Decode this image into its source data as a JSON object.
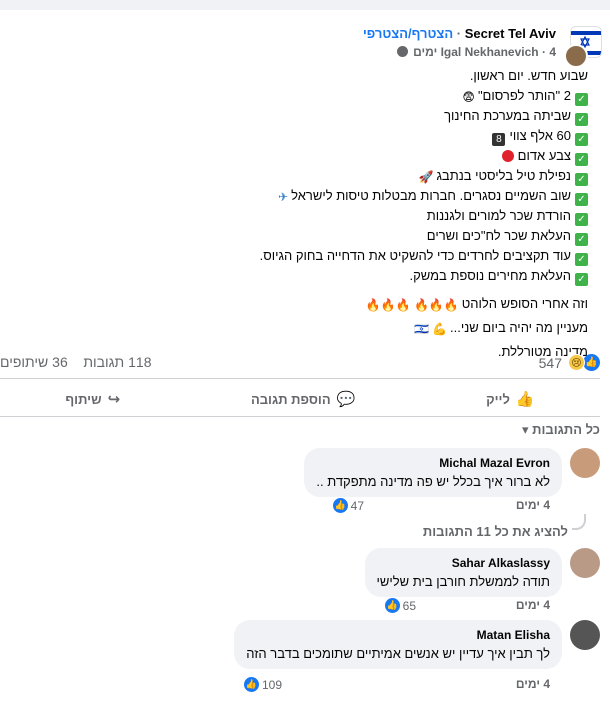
{
  "header": {
    "group_name": "Secret Tel Aviv",
    "separator": "·",
    "join_label": "הצטרף/הצטרפי",
    "author": "Igal Nekhanevich",
    "time": "4 ימים",
    "privacy_icon": "globe-icon"
  },
  "post": {
    "lines": [
      "שבוע חדש. יום ראשון.",
      "2 \"הותר לפרסום\"",
      "שביתה במערכת החינוך",
      "60 אלף צווי",
      "צבע אדום",
      "נפילת טיל בליסטי בנתבג",
      "שוב השמיים נסגרים. חברות מבטלות טיסות לישראל",
      "הורדת שכר למורים ולגננות",
      "העלאת שכר לח\"כים ושרים",
      "עוד תקציבים לחרדים כדי להשקיט את הדחייה בחוק הגיוס.",
      "העלאת מחירים נוספת במשק."
    ],
    "climax": "וזה אחרי הסופש הלוהט",
    "next": "מעניין מה יהיה ביום שני...",
    "closing": "מדינה מטורללת."
  },
  "stats": {
    "reactions": "547",
    "comments": "118 תגובות",
    "shares": "36 שיתופים"
  },
  "actions": {
    "like": "לייק",
    "comment": "הוספת תגובה",
    "share": "שיתוף"
  },
  "filter_label": "כל התגובות",
  "show_all": "להציג את כל 11 התגובות",
  "comments": [
    {
      "name": "Michal Mazal Evron",
      "text": "לא ברור איך בכלל יש פה מדינה מתפקדת ..",
      "time": "4 ימים",
      "likes": "47"
    },
    {
      "name": "Sahar Alkaslassy",
      "text": "תודה לממשלת חורבן בית שלישי",
      "time": "4 ימים",
      "likes": "65"
    },
    {
      "name": "Matan Elisha",
      "text": "לך תבין איך עדיין יש אנשים אמיתיים שתומכים בדבר הזה",
      "time": "4 ימים",
      "likes": "109"
    }
  ],
  "colors": {
    "accent": "#1877f2",
    "check": "#3fb24a",
    "secondary_text": "#65676b",
    "bubble": "#f0f2f5"
  }
}
